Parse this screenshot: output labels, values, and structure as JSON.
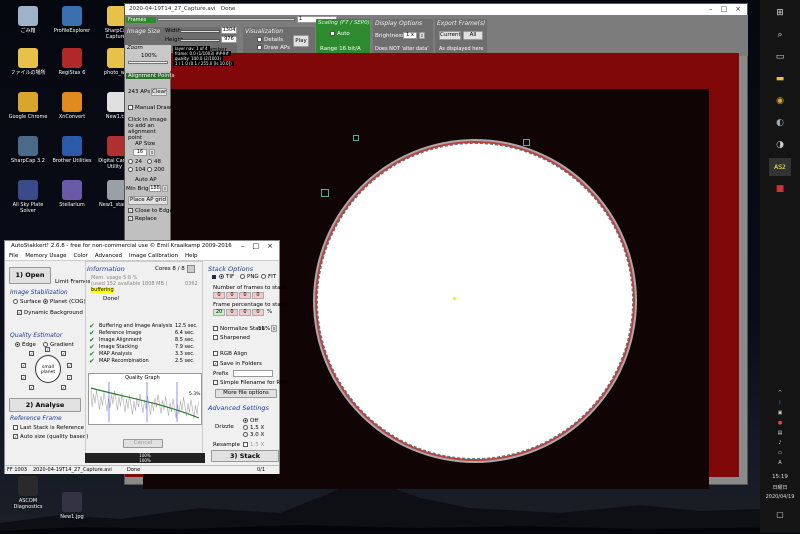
{
  "desktop": {
    "icons": [
      {
        "label": "ごみ箱",
        "icon": "recycle-bin-icon",
        "color": "#9fb4c8"
      },
      {
        "label": "ProfileExplorer",
        "icon": "profile-explorer-icon",
        "color": "#3a6fb0"
      },
      {
        "label": "SharpCap Captures",
        "icon": "folder-icon",
        "color": "#e8c14a"
      },
      {
        "label": "ファイルの場所",
        "icon": "folder-icon",
        "color": "#e8c14a"
      },
      {
        "label": "RegiStax 6",
        "icon": "registax-icon",
        "color": "#b02828"
      },
      {
        "label": "photo_wor",
        "icon": "folder-icon",
        "color": "#e8c14a"
      },
      {
        "label": "Google Chrome",
        "icon": "chrome-icon",
        "color": "#d9a52c"
      },
      {
        "label": "XnConvert",
        "icon": "xnconvert-icon",
        "color": "#e08a20"
      },
      {
        "label": "New1.txt",
        "icon": "text-file-icon",
        "color": "#e0e0e0"
      },
      {
        "label": "SharpCap 3.2",
        "icon": "sharpcap-icon",
        "color": "#4a6a8a"
      },
      {
        "label": "Brother Utilities",
        "icon": "brother-utilities-icon",
        "color": "#2a5aa8"
      },
      {
        "label": "Digital Camera Utility 5",
        "icon": "camera-utility-icon",
        "color": "#b03030"
      },
      {
        "label": "All Sky Plate Solver",
        "icon": "plate-solver-icon",
        "color": "#3a4a8a"
      },
      {
        "label": "Stellarium",
        "icon": "stellarium-icon",
        "color": "#6a5aa8"
      },
      {
        "label": "New1_starless",
        "icon": "image-file-icon",
        "color": "#9aa0a8"
      },
      {
        "label": "ASCOM Diagnostics",
        "icon": "ascom-icon",
        "color": "#2a2a2a"
      },
      {
        "label": "New1.jpg",
        "icon": "image-file-icon",
        "color": "#333344"
      }
    ]
  },
  "taskbar": {
    "time": "15:19",
    "day": "日曜日",
    "date": "2020/04/19",
    "pinned": [
      "windows-icon",
      "search-icon",
      "task-view-icon",
      "explorer-icon",
      "chrome-icon",
      "sharpcap-icon",
      "stellarium-icon",
      "astrometry-icon",
      "as-icon",
      "registax-icon"
    ],
    "pinned_label_as": "AS2"
  },
  "frame_window": {
    "title": "2020-04-19T14_27_Capture.avi",
    "status": "Done",
    "frames_label": "Frames",
    "frame_number": "1",
    "image_size": {
      "title": "Image Size",
      "width_label": "Width",
      "width_value": "1304",
      "height_label": "Height",
      "height_value": "976",
      "offset_label": "offset",
      "offset_value": "0",
      "offset_value2": "0",
      "remember_label": "remember"
    },
    "visualization": {
      "title": "Visualization",
      "details": "Details",
      "draw_aps": "Draw APs",
      "play": "Play"
    },
    "scaling": {
      "title": "Scaling (F7 / SEP0)",
      "auto": "Auto",
      "range": "Range 16 bit/A"
    },
    "display": {
      "title": "Display Options",
      "brightness_label": "Brightness",
      "brightness_value": "1 x",
      "note": "Does NOT 'alter data'"
    },
    "export": {
      "title": "Export Frame(s)",
      "current": "Current",
      "all": "All",
      "as_displayed": "As displayed here"
    },
    "zoom": {
      "title": "Zoom",
      "value": "100%"
    },
    "overlay": [
      "layer nav: 1 of 4",
      "frame: 0.0 (1/1003)  ####",
      "quality: 100.0  (2/1003)",
      "1 / 1 0  (0.1 / 255.0 [Is 10.0])"
    ],
    "alignment": {
      "title": "Alignment Points",
      "count": "243 APs",
      "clear": "Clear",
      "manual": "Manual Draw",
      "help": "Click in image to add an alignment point",
      "ap_size_title": "AP Size",
      "ap_size": "16",
      "sizes": [
        "24",
        "48",
        "104",
        "200"
      ],
      "auto_ap": "Auto AP",
      "min_bright_label": "Min Bright",
      "min_bright": "188",
      "place": "Place AP grid",
      "close_edge": "Close to Edge",
      "replace": "Replace"
    }
  },
  "as_window": {
    "title": "AutoStakkert! 2.6.8 - free for non-commercial use © Emil Kraaikamp 2009-2016",
    "menu": [
      "File",
      "Memory Usage",
      "Color",
      "Advanced",
      "Image Calibration",
      "Help"
    ],
    "open": "1) Open",
    "limit_frames": "Limit Frames",
    "stabilization": {
      "title": "Image Stabilization",
      "surface": "Surface",
      "planet": "Planet (COG)",
      "dynamic_bg": "Dynamic Background"
    },
    "quality": {
      "title": "Quality Estimator",
      "edge": "Edge",
      "gradient": "Gradient",
      "small_planet": "small planet"
    },
    "analyse": "2) Analyse",
    "reference": {
      "title": "Reference Frame",
      "last_stack": "Last Stack is Reference",
      "auto_size": "Auto size (quality based)"
    },
    "info": {
      "title": "Information",
      "cores": "Cores 8 / 8",
      "mem1": "Mem. usage 5.8 %",
      "mem2": "(used 152 available 1808 MB )",
      "code": "0362",
      "buffering": "buffering",
      "done": "Done!"
    },
    "timings": [
      {
        "label": "Buffering and Image Analysis",
        "value": "12.5 sec."
      },
      {
        "label": "Reference Image",
        "value": "6.4 sec."
      },
      {
        "label": "Image Alignment",
        "value": "8.5 sec."
      },
      {
        "label": "Image Stacking",
        "value": "7.9 sec."
      },
      {
        "label": "MAP Analysis",
        "value": "3.3 sec."
      },
      {
        "label": "MAP Recombination",
        "value": "2.5 sec."
      }
    ],
    "graph_title": "Quality Graph",
    "graph_label": "5.3%",
    "cancel": "Cancel",
    "progress1": "100%",
    "progress2": "100%",
    "stack_options": {
      "title": "Stack Options",
      "tif": "TIF",
      "png": "PNG",
      "fit": "FIT",
      "num_frames": "Number of frames to stack:",
      "frame_vals": [
        "0",
        "0",
        "0",
        "0"
      ],
      "frame_pct": "Frame percentage to stack:",
      "pct_vals": [
        "20",
        "0",
        "0",
        "0"
      ],
      "pct_sign": "%",
      "normalize": "Normalize Stack",
      "normalize_val": "55%",
      "sharpened": "Sharpened",
      "rgb_align": "RGB Align",
      "save_folders": "Save in Folders",
      "prefix": "Prefix",
      "simple_fn": "Simple Filename for RAW",
      "more": "More file options"
    },
    "advanced": {
      "title": "Advanced Settings",
      "drizzle": "Drizzle",
      "off": "Off",
      "d15": "1.5 X",
      "d30": "3.0 X",
      "resample": "Resample",
      "r15": "1.5 X"
    },
    "stack_btn": "3) Stack",
    "status": {
      "frames": "FF 1003",
      "file": "2020-04-19T14_27_Capture.avi",
      "state": "Done",
      "count": "0/1"
    }
  }
}
